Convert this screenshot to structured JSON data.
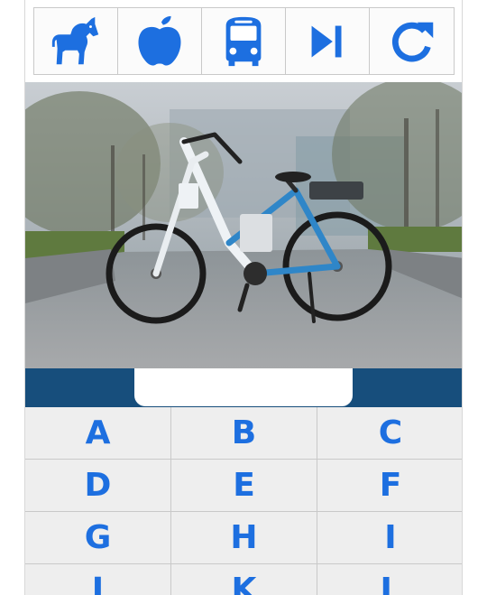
{
  "toolbar": {
    "buttons": [
      {
        "name": "horse-button",
        "icon": "horse-icon"
      },
      {
        "name": "apple-button",
        "icon": "apple-icon"
      },
      {
        "name": "bus-button",
        "icon": "bus-icon"
      },
      {
        "name": "skip-button",
        "icon": "skip-next-icon"
      },
      {
        "name": "reload-button",
        "icon": "redo-icon"
      }
    ],
    "icon_color": "#1d6fe0"
  },
  "photo": {
    "subject": "electric bicycle on cobblestone path",
    "icon": "bicycle-photo"
  },
  "answer": {
    "value": ""
  },
  "keypad": {
    "letters": [
      "A",
      "B",
      "C",
      "D",
      "E",
      "F",
      "G",
      "H",
      "I",
      "J",
      "K",
      "L"
    ]
  },
  "colors": {
    "accent": "#1d6fe0",
    "bar": "#174e7c",
    "key_bg": "#eeeeee"
  }
}
